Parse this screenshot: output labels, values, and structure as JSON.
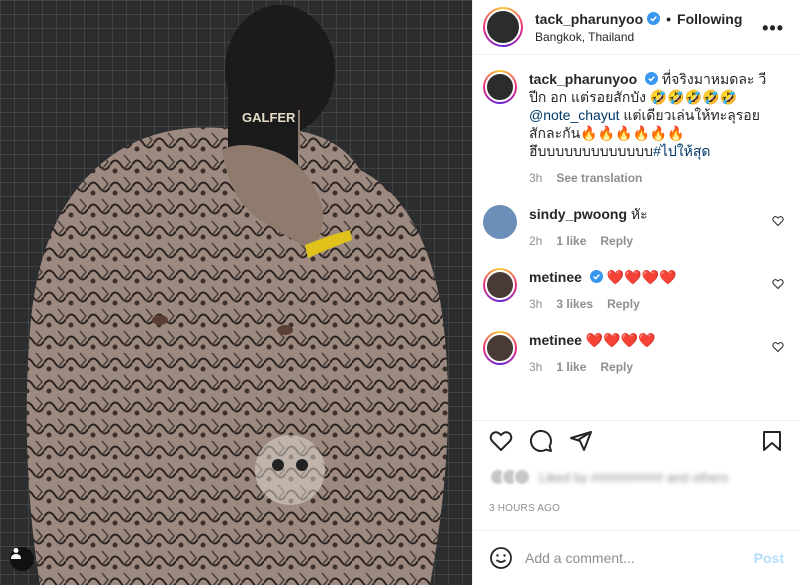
{
  "post": {
    "username": "tack_pharunyoo",
    "follow_status": "Following",
    "dot": "•",
    "location": "Bangkok, Thailand",
    "more": "•••"
  },
  "caption": {
    "username": "tack_pharunyoo",
    "text_1": "ที่จริงมาหมดละ วีปีก อก แต่รอยสักบัง",
    "mention": "@note_chayut",
    "text_2": " แต่เดียวเล่นให้ทะลุรอยสักละกัน",
    "text_3": "ฮึบบบบบบบบบบบบบ",
    "hashtag": "#ไปให้สุด",
    "time": "3h",
    "see_translation": "See translation"
  },
  "comments": [
    {
      "username": "sindy_pwoong",
      "text": "หัะ",
      "time": "2h",
      "likes": "1 like",
      "reply": "Reply"
    },
    {
      "username": "metinee",
      "text": "",
      "time": "3h",
      "likes": "3 likes",
      "reply": "Reply"
    },
    {
      "username": "metinee",
      "text": "",
      "time": "3h",
      "likes": "1 like",
      "reply": "Reply"
    }
  ],
  "footer": {
    "liked_by": "Liked by ########## and others",
    "timestamp": "3 HOURS AGO",
    "comment_placeholder": "Add a comment...",
    "post_label": "Post"
  },
  "icons": {
    "heart": "heart-icon",
    "comment": "comment-icon",
    "share": "share-icon",
    "save": "bookmark-icon",
    "emoji": "smiley-icon",
    "user_tag": "user-tag-icon"
  },
  "colors": {
    "verified": "#3897f0",
    "link": "#00376b",
    "red_heart": "#ed4956",
    "muted": "#8e8e8e"
  }
}
